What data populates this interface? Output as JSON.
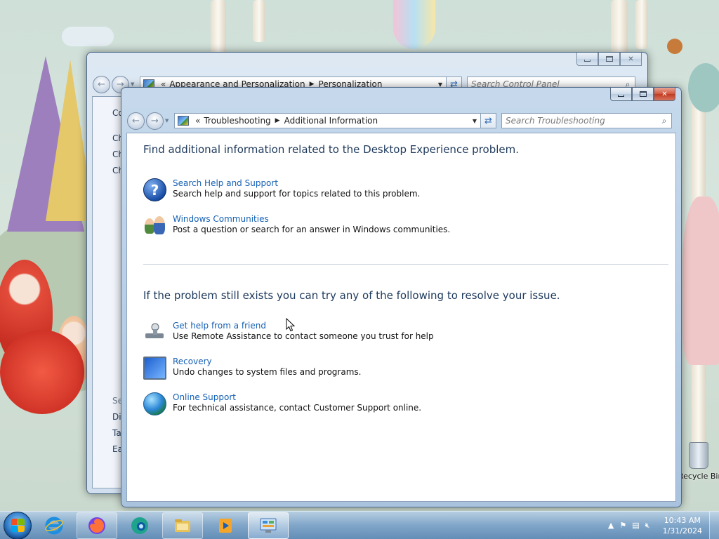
{
  "desktop": {
    "recycle_bin_label": "Recycle Bin"
  },
  "back_window": {
    "breadcrumb": [
      "Appearance and Personalization",
      "Personalization"
    ],
    "breadcrumb_prefix": "«",
    "search_placeholder": "Search Control Panel",
    "side_partial": [
      "Co",
      "Ch",
      "Ch",
      "Ch",
      "Se",
      "Di",
      "Ta",
      "Ea"
    ]
  },
  "front_window": {
    "breadcrumb": [
      "Troubleshooting",
      "Additional Information"
    ],
    "breadcrumb_prefix": "«",
    "search_placeholder": "Search Troubleshooting",
    "heading1": "Find additional information related to the Desktop Experience problem.",
    "heading2": "If the problem still exists you can try any of the following to resolve your issue.",
    "items": [
      {
        "icon": "help-icon",
        "title": "Search Help and Support",
        "desc": "Search help and support for topics related to this problem."
      },
      {
        "icon": "people-icon",
        "title": "Windows Communities",
        "desc": "Post a question or search for an answer in Windows communities."
      },
      {
        "icon": "remote-assistance-icon",
        "title": "Get help from a friend",
        "desc": "Use Remote Assistance to contact someone you trust for help"
      },
      {
        "icon": "recovery-icon",
        "title": "Recovery",
        "desc": "Undo changes to system files and programs."
      },
      {
        "icon": "globe-icon",
        "title": "Online Support",
        "desc": "For technical assistance, contact Customer Support online."
      }
    ]
  },
  "taskbar": {
    "apps": [
      "internet-explorer-icon",
      "firefox-icon",
      "edge-icon",
      "file-explorer-icon",
      "media-player-icon",
      "control-panel-icon"
    ],
    "time": "10:43 AM",
    "date": "1/31/2024"
  },
  "colors": {
    "link": "#1560b3",
    "heading": "#1e395b",
    "close_button": "#c03c22"
  }
}
